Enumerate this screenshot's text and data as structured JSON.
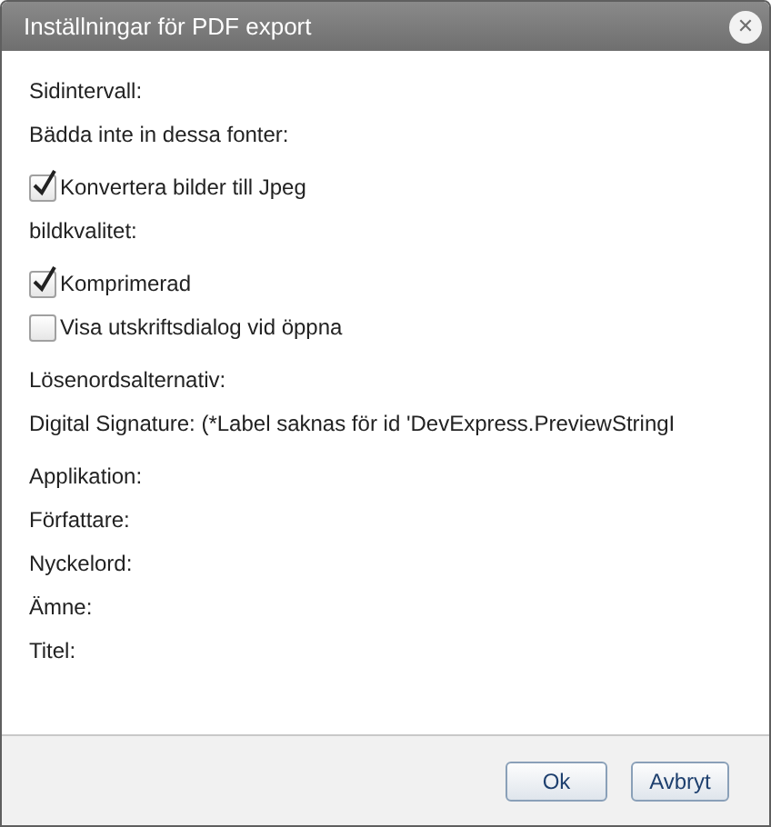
{
  "dialog": {
    "title": "Inställningar för PDF export",
    "close_symbol": "✕"
  },
  "sections": [
    {
      "items": [
        {
          "kind": "label",
          "text": "Sidintervall:"
        },
        {
          "kind": "label",
          "text": "Bädda inte in dessa fonter:"
        }
      ]
    },
    {
      "items": [
        {
          "kind": "checkbox",
          "text": "Konvertera bilder till Jpeg",
          "checked": true
        },
        {
          "kind": "label",
          "text": "bildkvalitet:"
        }
      ]
    },
    {
      "items": [
        {
          "kind": "checkbox",
          "text": "Komprimerad",
          "checked": true
        },
        {
          "kind": "checkbox",
          "text": "Visa utskriftsdialog vid öppna",
          "checked": false
        }
      ]
    },
    {
      "items": [
        {
          "kind": "label",
          "text": "Lösenordsalternativ:"
        },
        {
          "kind": "label",
          "text": "Digital Signature: (*Label saknas för id 'DevExpress.PreviewStringI"
        }
      ]
    },
    {
      "items": [
        {
          "kind": "label",
          "text": "Applikation:"
        },
        {
          "kind": "label",
          "text": "Författare:"
        },
        {
          "kind": "label",
          "text": "Nyckelord:"
        },
        {
          "kind": "label",
          "text": "Ämne:"
        },
        {
          "kind": "label",
          "text": "Titel:"
        }
      ]
    }
  ],
  "buttons": [
    "Ok",
    "Avbryt"
  ]
}
